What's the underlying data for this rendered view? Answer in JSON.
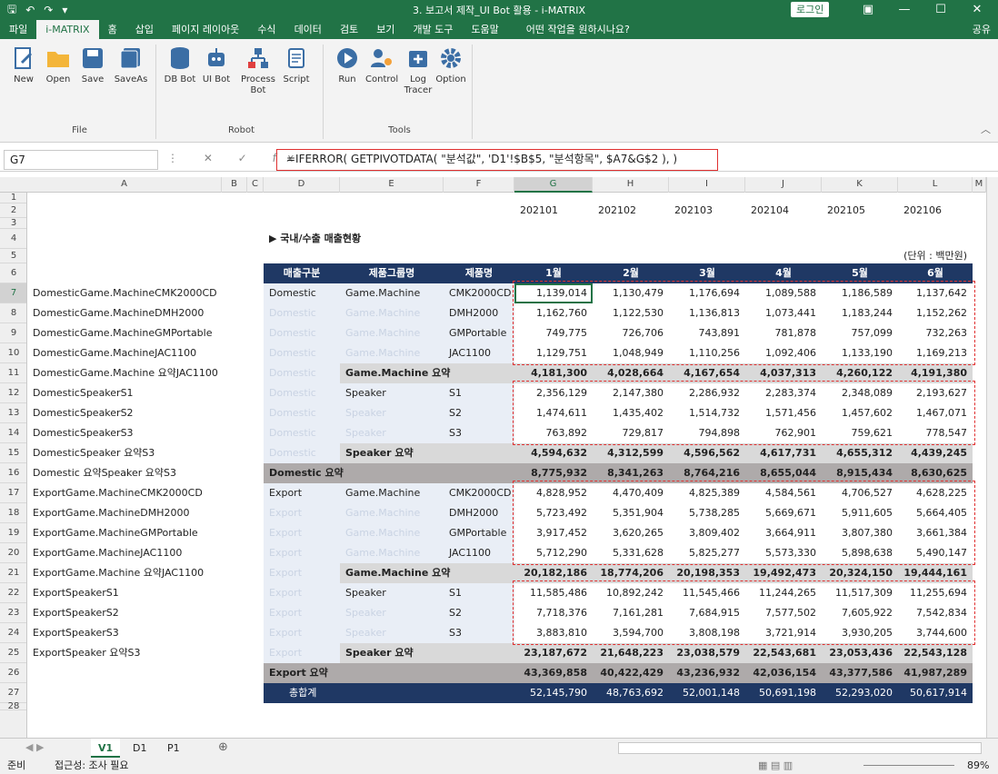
{
  "app": {
    "title": "3. 보고서 제작_UI Bot 활용 - i-MATRIX",
    "login": "로그인",
    "share": "공유"
  },
  "menu": [
    "파일",
    "i-MATRIX",
    "홈",
    "삽입",
    "페이지 레이아웃",
    "수식",
    "데이터",
    "검토",
    "보기",
    "개발 도구",
    "도움말",
    "어떤 작업을 원하시나요?"
  ],
  "ribbon": {
    "file": {
      "label": "File",
      "buttons": [
        "New",
        "Open",
        "Save",
        "SaveAs"
      ]
    },
    "robot": {
      "label": "Robot",
      "buttons": [
        "DB Bot",
        "UI Bot",
        "Process Bot",
        "Script"
      ]
    },
    "tools": {
      "label": "Tools",
      "buttons": [
        "Run",
        "Control",
        "Log Tracer",
        "Option"
      ]
    }
  },
  "formula": {
    "namebox": "G7",
    "text": "=IFERROR( GETPIVOTDATA( \"분석값\", 'D1'!$B$5, \"분석항목\",  $A7&G$2 ), )"
  },
  "columns": [
    "A",
    "B",
    "C",
    "D",
    "E",
    "F",
    "G",
    "H",
    "I",
    "J",
    "K",
    "L",
    "M"
  ],
  "sheet": {
    "periods": [
      "202101",
      "202102",
      "202103",
      "202104",
      "202105",
      "202106"
    ],
    "section_title": "▶ 국내/수출 매출현황",
    "unit": "(단위 : 백만원)",
    "headers": [
      "매출구분",
      "제품그룹명",
      "제품명",
      "1월",
      "2월",
      "3월",
      "4월",
      "5월",
      "6월"
    ],
    "rows": [
      {
        "key": "DomesticGame.MachineCMK2000CD",
        "seg": "Domestic",
        "grp": "Game.Machine",
        "prod": "CMK2000CD",
        "vals": [
          "1,139,014",
          "1,130,479",
          "1,176,694",
          "1,089,588",
          "1,186,589",
          "1,137,642"
        ],
        "kind": "detail",
        "segShow": true,
        "grpShow": true
      },
      {
        "key": "DomesticGame.MachineDMH2000",
        "seg": "Domestic",
        "grp": "Game.Machine",
        "prod": "DMH2000",
        "vals": [
          "1,162,760",
          "1,122,530",
          "1,136,813",
          "1,073,441",
          "1,183,244",
          "1,152,262"
        ],
        "kind": "detail"
      },
      {
        "key": "DomesticGame.MachineGMPortable",
        "seg": "Domestic",
        "grp": "Game.Machine",
        "prod": "GMPortable",
        "vals": [
          "749,775",
          "726,706",
          "743,891",
          "781,878",
          "757,099",
          "732,263"
        ],
        "kind": "detail"
      },
      {
        "key": "DomesticGame.MachineJAC1100",
        "seg": "Domestic",
        "grp": "Game.Machine",
        "prod": "JAC1100",
        "vals": [
          "1,129,751",
          "1,048,949",
          "1,110,256",
          "1,092,406",
          "1,133,190",
          "1,169,213"
        ],
        "kind": "detail"
      },
      {
        "key": "DomesticGame.Machine 요약JAC1100",
        "seg": "Domestic",
        "grp": "Game.Machine 요약",
        "prod": "",
        "vals": [
          "4,181,300",
          "4,028,664",
          "4,167,654",
          "4,037,313",
          "4,260,122",
          "4,191,380"
        ],
        "kind": "sub"
      },
      {
        "key": "DomesticSpeakerS1",
        "seg": "Domestic",
        "grp": "Speaker",
        "prod": "S1",
        "vals": [
          "2,356,129",
          "2,147,380",
          "2,286,932",
          "2,283,374",
          "2,348,089",
          "2,193,627"
        ],
        "kind": "detail",
        "grpShow": true
      },
      {
        "key": "DomesticSpeakerS2",
        "seg": "Domestic",
        "grp": "Speaker",
        "prod": "S2",
        "vals": [
          "1,474,611",
          "1,435,402",
          "1,514,732",
          "1,571,456",
          "1,457,602",
          "1,467,071"
        ],
        "kind": "detail"
      },
      {
        "key": "DomesticSpeakerS3",
        "seg": "Domestic",
        "grp": "Speaker",
        "prod": "S3",
        "vals": [
          "763,892",
          "729,817",
          "794,898",
          "762,901",
          "759,621",
          "778,547"
        ],
        "kind": "detail"
      },
      {
        "key": "DomesticSpeaker 요약S3",
        "seg": "Domestic",
        "grp": "Speaker 요약",
        "prod": "",
        "vals": [
          "4,594,632",
          "4,312,599",
          "4,596,562",
          "4,617,731",
          "4,655,312",
          "4,439,245"
        ],
        "kind": "sub"
      },
      {
        "key": "Domestic 요약Speaker 요약S3",
        "seg": "Domestic 요약",
        "grp": "",
        "prod": "",
        "vals": [
          "8,775,932",
          "8,341,263",
          "8,764,216",
          "8,655,044",
          "8,915,434",
          "8,630,625"
        ],
        "kind": "dom"
      },
      {
        "key": "ExportGame.MachineCMK2000CD",
        "seg": "Export",
        "grp": "Game.Machine",
        "prod": "CMK2000CD",
        "vals": [
          "4,828,952",
          "4,470,409",
          "4,825,389",
          "4,584,561",
          "4,706,527",
          "4,628,225"
        ],
        "kind": "detail",
        "segShow": true,
        "grpShow": true
      },
      {
        "key": "ExportGame.MachineDMH2000",
        "seg": "Export",
        "grp": "Game.Machine",
        "prod": "DMH2000",
        "vals": [
          "5,723,492",
          "5,351,904",
          "5,738,285",
          "5,669,671",
          "5,911,605",
          "5,664,405"
        ],
        "kind": "detail"
      },
      {
        "key": "ExportGame.MachineGMPortable",
        "seg": "Export",
        "grp": "Game.Machine",
        "prod": "GMPortable",
        "vals": [
          "3,917,452",
          "3,620,265",
          "3,809,402",
          "3,664,911",
          "3,807,380",
          "3,661,384"
        ],
        "kind": "detail"
      },
      {
        "key": "ExportGame.MachineJAC1100",
        "seg": "Export",
        "grp": "Game.Machine",
        "prod": "JAC1100",
        "vals": [
          "5,712,290",
          "5,331,628",
          "5,825,277",
          "5,573,330",
          "5,898,638",
          "5,490,147"
        ],
        "kind": "detail"
      },
      {
        "key": "ExportGame.Machine 요약JAC1100",
        "seg": "Export",
        "grp": "Game.Machine 요약",
        "prod": "",
        "vals": [
          "20,182,186",
          "18,774,206",
          "20,198,353",
          "19,492,473",
          "20,324,150",
          "19,444,161"
        ],
        "kind": "sub"
      },
      {
        "key": "ExportSpeakerS1",
        "seg": "Export",
        "grp": "Speaker",
        "prod": "S1",
        "vals": [
          "11,585,486",
          "10,892,242",
          "11,545,466",
          "11,244,265",
          "11,517,309",
          "11,255,694"
        ],
        "kind": "detail",
        "grpShow": true
      },
      {
        "key": "ExportSpeakerS2",
        "seg": "Export",
        "grp": "Speaker",
        "prod": "S2",
        "vals": [
          "7,718,376",
          "7,161,281",
          "7,684,915",
          "7,577,502",
          "7,605,922",
          "7,542,834"
        ],
        "kind": "detail"
      },
      {
        "key": "ExportSpeakerS3",
        "seg": "Export",
        "grp": "Speaker",
        "prod": "S3",
        "vals": [
          "3,883,810",
          "3,594,700",
          "3,808,198",
          "3,721,914",
          "3,930,205",
          "3,744,600"
        ],
        "kind": "detail"
      },
      {
        "key": "ExportSpeaker 요약S3",
        "seg": "Export",
        "grp": "Speaker 요약",
        "prod": "",
        "vals": [
          "23,187,672",
          "21,648,223",
          "23,038,579",
          "22,543,681",
          "23,053,436",
          "22,543,128"
        ],
        "kind": "sub"
      },
      {
        "key": "",
        "seg": "Export 요약",
        "grp": "",
        "prod": "",
        "vals": [
          "43,369,858",
          "40,422,429",
          "43,236,932",
          "42,036,154",
          "43,377,586",
          "41,987,289"
        ],
        "kind": "dom"
      },
      {
        "key": "",
        "seg": "총합계",
        "grp": "",
        "prod": "",
        "vals": [
          "52,145,790",
          "48,763,692",
          "52,001,148",
          "50,691,198",
          "52,293,020",
          "50,617,914"
        ],
        "kind": "total"
      }
    ]
  },
  "tabs": [
    "V1",
    "D1",
    "P1"
  ],
  "status": {
    "ready": "준비",
    "accessibility": "접근성: 조사 필요",
    "zoom": "89%"
  }
}
